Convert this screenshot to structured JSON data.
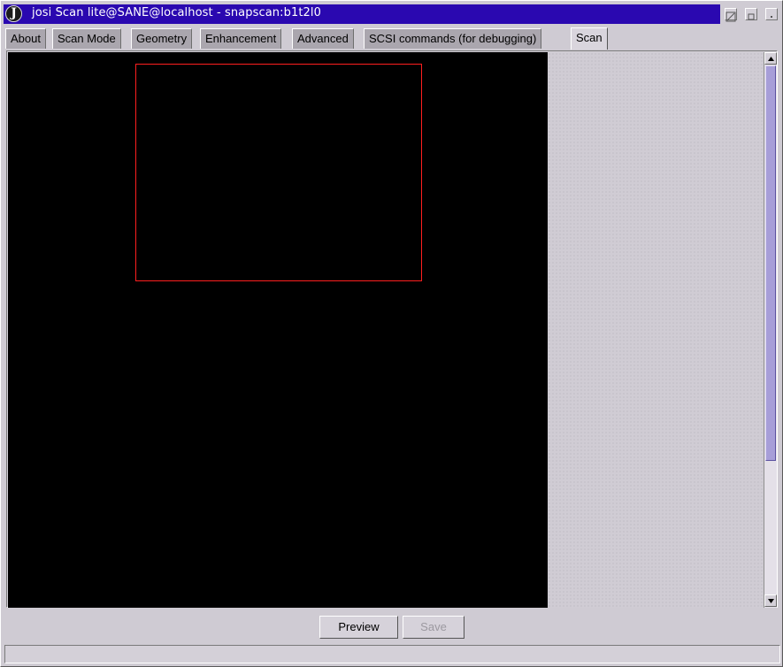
{
  "window": {
    "title": "josi Scan lite@SANE@localhost - snapscan:b1t2l0",
    "app_icon_letter": "J",
    "colors": {
      "titlebar": "#2a08b0",
      "selection": "#ff1f1f",
      "scroll_thumb": "#a79ed8"
    }
  },
  "tabs": [
    {
      "label": "About",
      "active": false
    },
    {
      "label": "Scan Mode",
      "active": false
    },
    {
      "label": "Geometry",
      "active": false
    },
    {
      "label": "Enhancement",
      "active": false
    },
    {
      "label": "Advanced",
      "active": false
    },
    {
      "label": "SCSI commands (for debugging)",
      "active": false
    },
    {
      "label": "Scan",
      "active": true
    }
  ],
  "buttons": {
    "preview": "Preview",
    "save": "Save"
  },
  "status": {
    "text": ""
  },
  "icons": {
    "window_controls": [
      "maximize-icon",
      "minimize-icon",
      "close-icon"
    ],
    "scroll": [
      "scroll-up-icon",
      "scroll-down-icon"
    ]
  }
}
